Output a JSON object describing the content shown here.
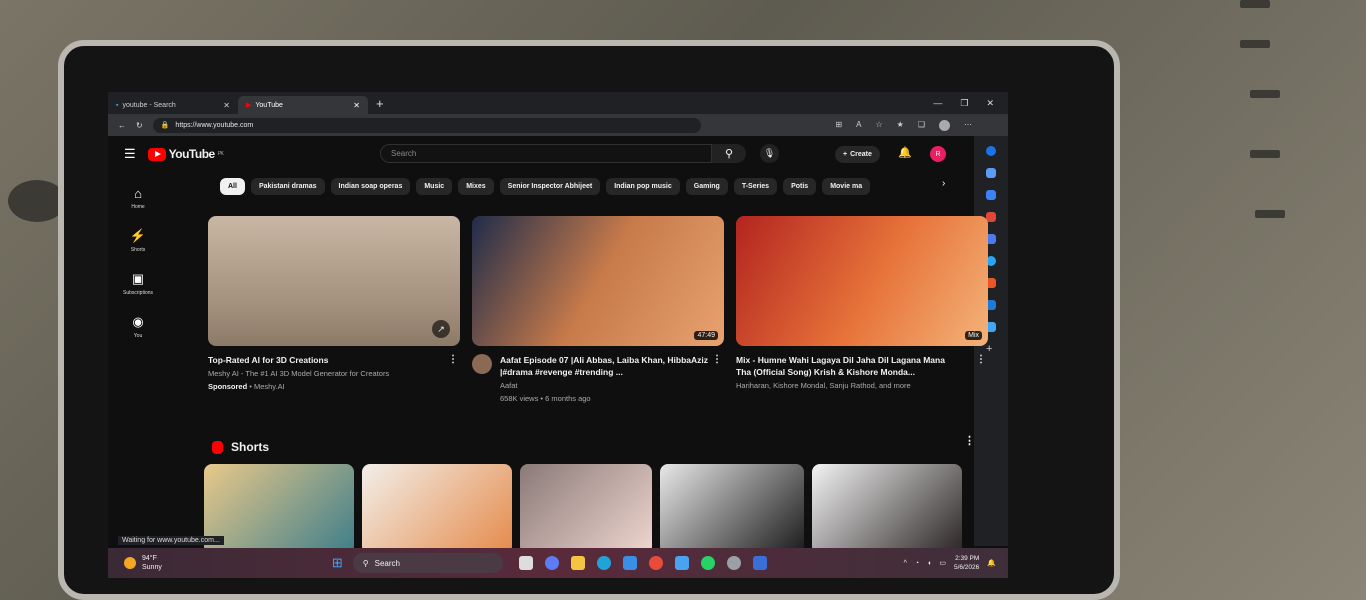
{
  "browser": {
    "tabs": [
      {
        "title": "youtube - Search",
        "active": false
      },
      {
        "title": "YouTube",
        "active": true
      }
    ],
    "url": "https://www.youtube.com",
    "status": "Waiting for www.youtube.com..."
  },
  "youtube": {
    "logo": "YouTube",
    "logo_region": "PK",
    "search_placeholder": "Search",
    "create_label": "Create",
    "avatar_letter": "R",
    "chips": [
      "All",
      "Pakistani dramas",
      "Indian soap operas",
      "Music",
      "Mixes",
      "Senior Inspector Abhijeet",
      "Indian pop music",
      "Gaming",
      "T-Series",
      "Potis",
      "Movie ma"
    ],
    "rail": [
      {
        "label": "Home",
        "icon": "home-icon"
      },
      {
        "label": "Shorts",
        "icon": "shorts-icon"
      },
      {
        "label": "Subscriptions",
        "icon": "subscriptions-icon"
      },
      {
        "label": "You",
        "icon": "you-icon"
      }
    ],
    "videos": [
      {
        "title": "Top-Rated AI for 3D Creations",
        "line1": "Meshy AI - The #1 AI 3D Model Generator for Creators",
        "sponsored": "Sponsored",
        "line2": " • Meshy.AI",
        "duration": ""
      },
      {
        "title": "Aafat Episode 07 |Ali Abbas, Laiba Khan, HibbaAziz |#drama #revenge  #trending ...",
        "line1": "Aafat",
        "sponsored": "",
        "line2": "658K views • 6 months ago",
        "duration": "47:49"
      },
      {
        "title": "Mix - Humne Wahi Lagaya Dil Jaha Dil Lagana Mana Tha (Official Song) Krish & Kishore Monda...",
        "line1": "Hariharan, Kishore Mondal, Sanju Rathod, and more",
        "sponsored": "",
        "line2": "",
        "duration": "Mix"
      }
    ],
    "shorts_heading": "Shorts"
  },
  "taskbar": {
    "weather_temp": "94°F",
    "weather_desc": "Sunny",
    "search_label": "Search",
    "time": "2:39 PM",
    "date": "5/6/2026"
  }
}
